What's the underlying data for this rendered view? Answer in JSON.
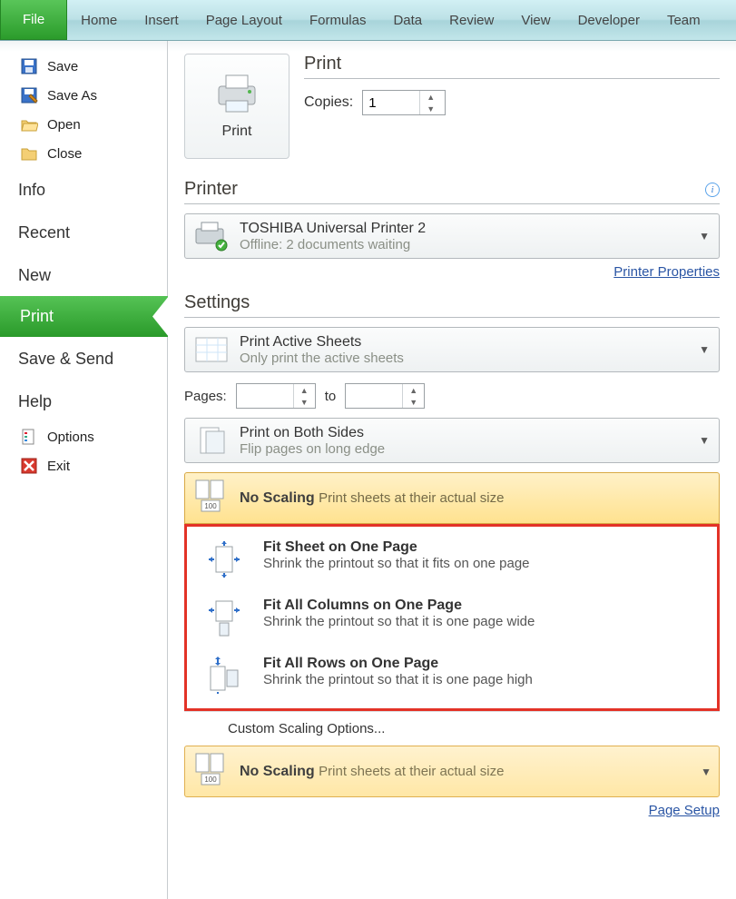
{
  "ribbon": {
    "file": "File",
    "tabs": [
      "Home",
      "Insert",
      "Page Layout",
      "Formulas",
      "Data",
      "Review",
      "View",
      "Developer",
      "Team"
    ]
  },
  "leftnav": {
    "save": "Save",
    "saveas": "Save As",
    "open": "Open",
    "close": "Close",
    "info": "Info",
    "recent": "Recent",
    "new": "New",
    "print": "Print",
    "savesend": "Save & Send",
    "help": "Help",
    "options": "Options",
    "exit": "Exit"
  },
  "print_section": {
    "header": "Print",
    "button": "Print",
    "copies_label": "Copies:",
    "copies_value": "1"
  },
  "printer_section": {
    "header": "Printer",
    "name": "TOSHIBA Universal Printer 2",
    "status": "Offline: 2 documents waiting",
    "props_link": "Printer Properties"
  },
  "settings_section": {
    "header": "Settings",
    "what": {
      "title": "Print Active Sheets",
      "sub": "Only print the active sheets"
    },
    "pages_label": "Pages:",
    "to_label": "to",
    "sides": {
      "title": "Print on Both Sides",
      "sub": "Flip pages on long edge"
    }
  },
  "scaling": {
    "current": {
      "title": "No Scaling",
      "sub": "Print sheets at their actual size"
    },
    "options": [
      {
        "title": "Fit Sheet on One Page",
        "sub": "Shrink the printout so that it fits on one page"
      },
      {
        "title": "Fit All Columns on One Page",
        "sub": "Shrink the printout so that it is one page wide"
      },
      {
        "title": "Fit All Rows on One Page",
        "sub": "Shrink the printout so that it is one page high"
      }
    ],
    "custom": "Custom Scaling Options...",
    "dup": {
      "title": "No Scaling",
      "sub": "Print sheets at their actual size"
    }
  },
  "page_setup_link": "Page Setup"
}
